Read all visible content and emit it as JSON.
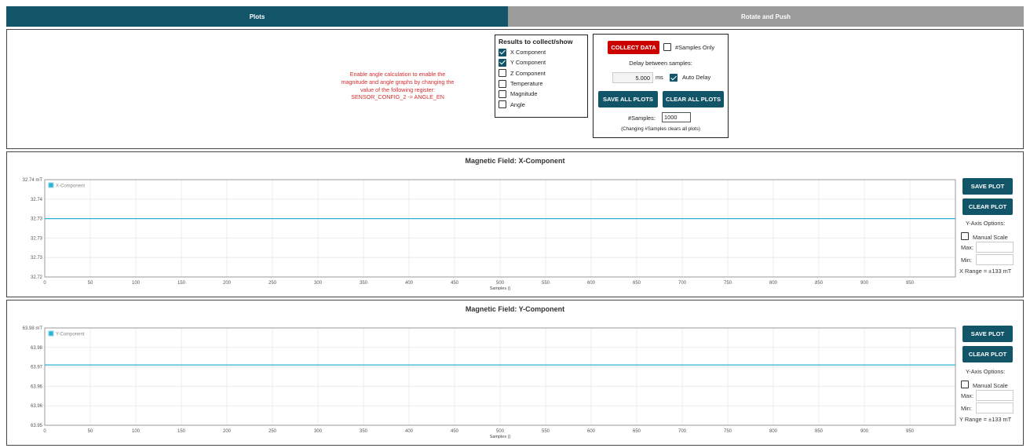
{
  "tabs": [
    {
      "label": "Plots",
      "active": true
    },
    {
      "label": "Rotate and Push",
      "active": false
    }
  ],
  "angle_message": "Enable angle calculation to enable the magnitude and angle graphs by changing the value of the following register: SENSOR_CONFIG_2 -> ANGLE_EN",
  "results": {
    "title": "Results to collect/show",
    "items": [
      {
        "label": "X Component",
        "checked": true
      },
      {
        "label": "Y Component",
        "checked": true
      },
      {
        "label": "Z Component",
        "checked": false
      },
      {
        "label": "Temperature",
        "checked": false
      },
      {
        "label": "Magnitude",
        "checked": false
      },
      {
        "label": "Angle",
        "checked": false
      }
    ]
  },
  "collect": {
    "collect_label": "COLLECT DATA",
    "samples_only_label": "#Samples Only",
    "samples_only_checked": false,
    "delay_label": "Delay between samples:",
    "delay_value": "5.000",
    "delay_unit": "ms",
    "auto_delay_label": "Auto Delay",
    "auto_delay_checked": true,
    "save_all_label": "SAVE ALL PLOTS",
    "clear_all_label": "CLEAR ALL PLOTS",
    "samples_label": "#Samples:",
    "samples_value": "1000",
    "samples_note": "(Changing #Samples clears all plots)"
  },
  "colors": {
    "accent": "#125468",
    "danger": "#cc0000",
    "series": "#2bb3d6",
    "inactive_tab": "#9b9b9b",
    "warning_text": "#d62c2c"
  },
  "plots": [
    {
      "title": "Magnetic Field: X-Component",
      "save_label": "SAVE PLOT",
      "clear_label": "CLEAR PLOT",
      "yaxis_options_label": "Y-Axis Options:",
      "manual_scale_label": "Manual Scale",
      "max_label": "Max:",
      "min_label": "Min:",
      "range_text": "X Range = ±133 mT"
    },
    {
      "title": "Magnetic Field: Y-Component",
      "save_label": "SAVE PLOT",
      "clear_label": "CLEAR PLOT",
      "yaxis_options_label": "Y-Axis Options:",
      "manual_scale_label": "Manual Scale",
      "max_label": "Max:",
      "min_label": "Min:",
      "range_text": "Y Range = ±133 mT"
    }
  ],
  "chart_data": [
    {
      "type": "line",
      "title": "",
      "xlabel": "Samples ()",
      "ylabel": "",
      "x_ticks": [
        0,
        50,
        100,
        150,
        200,
        250,
        300,
        350,
        400,
        450,
        500,
        550,
        600,
        650,
        700,
        750,
        800,
        850,
        900,
        950
      ],
      "y_tick_labels": [
        "32.74 mT",
        "32.74",
        "32.73",
        "32.73",
        "32.73",
        "32.72"
      ],
      "xlim": [
        0,
        1000
      ],
      "ylim": [
        32.72,
        32.74
      ],
      "grid": true,
      "legend": "top-left",
      "series": [
        {
          "name": "X-Component",
          "x": [
            0,
            1000
          ],
          "y": [
            32.732,
            32.732
          ]
        }
      ]
    },
    {
      "type": "line",
      "title": "",
      "xlabel": "Samples ()",
      "ylabel": "",
      "x_ticks": [
        0,
        50,
        100,
        150,
        200,
        250,
        300,
        350,
        400,
        450,
        500,
        550,
        600,
        650,
        700,
        750,
        800,
        850,
        900,
        950
      ],
      "y_tick_labels": [
        "63.98 mT",
        "63.98",
        "63.97",
        "63.96",
        "63.96",
        "63.95"
      ],
      "xlim": [
        0,
        1000
      ],
      "ylim": [
        63.95,
        63.98
      ],
      "grid": true,
      "legend": "top-left",
      "series": [
        {
          "name": "Y-Component",
          "x": [
            0,
            1000
          ],
          "y": [
            63.9686,
            63.9686
          ]
        }
      ]
    }
  ]
}
